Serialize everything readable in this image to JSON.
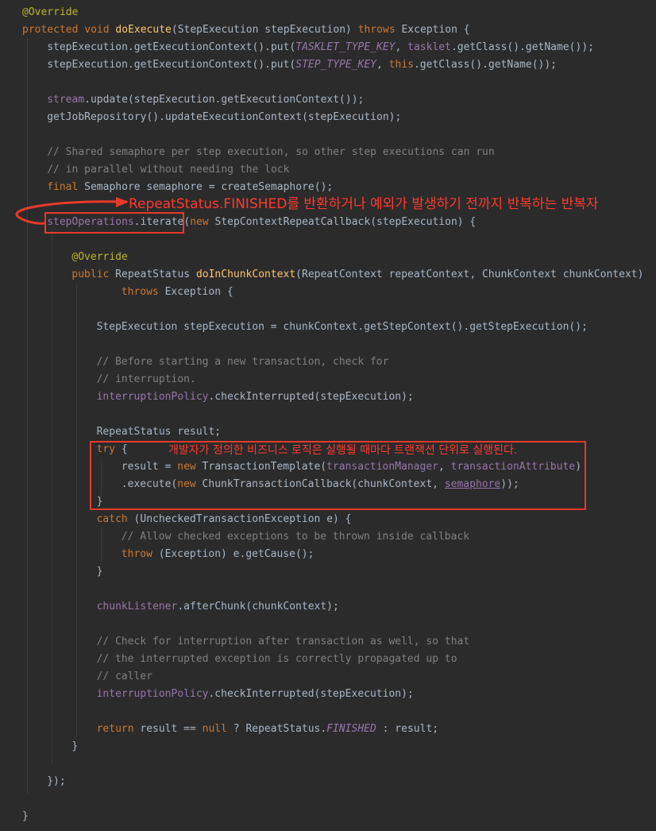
{
  "code": {
    "lines": [
      {
        "indent": 0,
        "tokens": [
          {
            "t": "@Override",
            "c": "ann"
          }
        ]
      },
      {
        "indent": 0,
        "tokens": [
          {
            "t": "protected",
            "c": "kw"
          },
          {
            "t": " "
          },
          {
            "t": "void",
            "c": "kw"
          },
          {
            "t": " "
          },
          {
            "t": "doExecute",
            "c": "fn"
          },
          {
            "t": "(StepExecution stepExecution) "
          },
          {
            "t": "throws",
            "c": "kw"
          },
          {
            "t": " Exception {"
          }
        ]
      },
      {
        "indent": 1,
        "tokens": [
          {
            "t": "stepExecution.getExecutionContext().put("
          },
          {
            "t": "TASKLET_TYPE_KEY",
            "c": "cst"
          },
          {
            "t": ", "
          },
          {
            "t": "tasklet",
            "c": "fld"
          },
          {
            "t": ".getClass().getName());"
          }
        ]
      },
      {
        "indent": 1,
        "tokens": [
          {
            "t": "stepExecution.getExecutionContext().put("
          },
          {
            "t": "STEP_TYPE_KEY",
            "c": "cst"
          },
          {
            "t": ", "
          },
          {
            "t": "this",
            "c": "kw"
          },
          {
            "t": ".getClass().getName());"
          }
        ]
      },
      {
        "indent": 0,
        "tokens": []
      },
      {
        "indent": 1,
        "tokens": [
          {
            "t": "stream",
            "c": "fld"
          },
          {
            "t": ".update(stepExecution.getExecutionContext());"
          }
        ]
      },
      {
        "indent": 1,
        "tokens": [
          {
            "t": "getJobRepository().updateExecutionContext(stepExecution);"
          }
        ]
      },
      {
        "indent": 0,
        "tokens": []
      },
      {
        "indent": 1,
        "tokens": [
          {
            "t": "// Shared semaphore per step execution, so other step executions can run",
            "c": "cm"
          }
        ]
      },
      {
        "indent": 1,
        "tokens": [
          {
            "t": "// in parallel without needing the lock",
            "c": "cm"
          }
        ]
      },
      {
        "indent": 1,
        "tokens": [
          {
            "t": "final",
            "c": "kw"
          },
          {
            "t": " Semaphore semaphore = createSemaphore();"
          }
        ]
      },
      {
        "indent": 0,
        "tokens": []
      },
      {
        "indent": 1,
        "tokens": [
          {
            "t": "stepOperations",
            "c": "fld"
          },
          {
            "t": ".iterate("
          },
          {
            "t": "new",
            "c": "kw"
          },
          {
            "t": " StepContextRepeatCallback(stepExecution) {"
          }
        ]
      },
      {
        "indent": 0,
        "tokens": []
      },
      {
        "indent": 2,
        "tokens": [
          {
            "t": "@Override",
            "c": "ann"
          }
        ]
      },
      {
        "indent": 2,
        "tokens": [
          {
            "t": "public",
            "c": "kw"
          },
          {
            "t": " RepeatStatus "
          },
          {
            "t": "doInChunkContext",
            "c": "fn"
          },
          {
            "t": "(RepeatContext repeatContext, ChunkContext chunkContext)"
          }
        ]
      },
      {
        "indent": 4,
        "tokens": [
          {
            "t": "throws",
            "c": "kw"
          },
          {
            "t": " Exception {"
          }
        ]
      },
      {
        "indent": 0,
        "tokens": []
      },
      {
        "indent": 3,
        "tokens": [
          {
            "t": "StepExecution stepExecution = chunkContext.getStepContext().getStepExecution();"
          }
        ]
      },
      {
        "indent": 0,
        "tokens": []
      },
      {
        "indent": 3,
        "tokens": [
          {
            "t": "// Before starting a new transaction, check for",
            "c": "cm"
          }
        ]
      },
      {
        "indent": 3,
        "tokens": [
          {
            "t": "// interruption.",
            "c": "cm"
          }
        ]
      },
      {
        "indent": 3,
        "tokens": [
          {
            "t": "interruptionPolicy",
            "c": "fld"
          },
          {
            "t": ".checkInterrupted(stepExecution);"
          }
        ]
      },
      {
        "indent": 0,
        "tokens": []
      },
      {
        "indent": 3,
        "tokens": [
          {
            "t": "RepeatStatus result;"
          }
        ]
      },
      {
        "indent": 3,
        "tokens": [
          {
            "t": "try",
            "c": "kw"
          },
          {
            "t": " {"
          }
        ]
      },
      {
        "indent": 4,
        "tokens": [
          {
            "t": "result = "
          },
          {
            "t": "new",
            "c": "kw"
          },
          {
            "t": " TransactionTemplate("
          },
          {
            "t": "transactionManager",
            "c": "fld"
          },
          {
            "t": ", "
          },
          {
            "t": "transactionAttribute",
            "c": "fld"
          },
          {
            "t": ")"
          }
        ]
      },
      {
        "indent": 4,
        "tokens": [
          {
            "t": ".execute("
          },
          {
            "t": "new",
            "c": "kw"
          },
          {
            "t": " ChunkTransactionCallback(chunkContext, "
          },
          {
            "t": "semaphore",
            "c": "fld und"
          },
          {
            "t": "));"
          }
        ]
      },
      {
        "indent": 3,
        "tokens": [
          {
            "t": "}"
          }
        ]
      },
      {
        "indent": 3,
        "tokens": [
          {
            "t": "catch",
            "c": "kw"
          },
          {
            "t": " (UncheckedTransactionException e) {"
          }
        ]
      },
      {
        "indent": 4,
        "tokens": [
          {
            "t": "// Allow checked exceptions to be thrown inside callback",
            "c": "cm"
          }
        ]
      },
      {
        "indent": 4,
        "tokens": [
          {
            "t": "throw",
            "c": "kw"
          },
          {
            "t": " (Exception) e.getCause();"
          }
        ]
      },
      {
        "indent": 3,
        "tokens": [
          {
            "t": "}"
          }
        ]
      },
      {
        "indent": 0,
        "tokens": []
      },
      {
        "indent": 3,
        "tokens": [
          {
            "t": "chunkListener",
            "c": "fld"
          },
          {
            "t": ".afterChunk(chunkContext);"
          }
        ]
      },
      {
        "indent": 0,
        "tokens": []
      },
      {
        "indent": 3,
        "tokens": [
          {
            "t": "// Check for interruption after transaction as well, so that",
            "c": "cm"
          }
        ]
      },
      {
        "indent": 3,
        "tokens": [
          {
            "t": "// the interrupted exception is correctly propagated up to",
            "c": "cm"
          }
        ]
      },
      {
        "indent": 3,
        "tokens": [
          {
            "t": "// caller",
            "c": "cm"
          }
        ]
      },
      {
        "indent": 3,
        "tokens": [
          {
            "t": "interruptionPolicy",
            "c": "fld"
          },
          {
            "t": ".checkInterrupted(stepExecution);"
          }
        ]
      },
      {
        "indent": 0,
        "tokens": []
      },
      {
        "indent": 3,
        "tokens": [
          {
            "t": "return",
            "c": "kw"
          },
          {
            "t": " result == "
          },
          {
            "t": "null",
            "c": "kw"
          },
          {
            "t": " ? RepeatStatus."
          },
          {
            "t": "FINISHED",
            "c": "cst"
          },
          {
            "t": " : result;"
          }
        ]
      },
      {
        "indent": 2,
        "tokens": [
          {
            "t": "}"
          }
        ]
      },
      {
        "indent": 0,
        "tokens": []
      },
      {
        "indent": 1,
        "tokens": [
          {
            "t": "});"
          }
        ]
      },
      {
        "indent": 0,
        "tokens": []
      },
      {
        "indent": 0,
        "tokens": [
          {
            "t": "}"
          }
        ]
      }
    ]
  },
  "annotations": {
    "iterate_note": "RepeatStatus.FINISHED를 반환하거나 예외가 발생하기 전까지 반복하는 반복자",
    "transaction_note": "개발자가 정의한 비즈니스 로직은 실행될 때마다 트랜잭션 단위로 실행된다."
  },
  "colors": {
    "background": "#2b2b2b",
    "annotation": "#ff3b2f",
    "keyword": "#cc7832",
    "annotation_tag": "#bbb529",
    "method": "#ffc66d",
    "field": "#9876aa",
    "comment": "#808080",
    "text": "#a9b7c6"
  }
}
